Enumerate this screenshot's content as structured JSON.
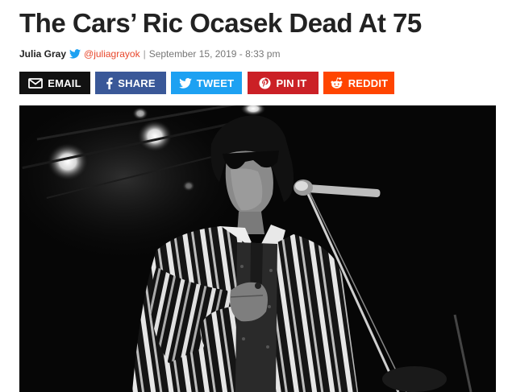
{
  "article": {
    "headline": "The Cars’ Ric Ocasek Dead At 75",
    "author": "Julia Gray",
    "twitter_handle": "@juliagrayok",
    "separator": "|",
    "date": "September 15, 2019 - 8:33 pm"
  },
  "share_buttons": {
    "email": {
      "label": "EMAIL",
      "icon": "envelope-icon",
      "color": "#111111"
    },
    "facebook": {
      "label": "SHARE",
      "icon": "facebook-icon",
      "color": "#3a5898"
    },
    "twitter": {
      "label": "TWEET",
      "icon": "twitter-icon",
      "color": "#1da1f2"
    },
    "pinterest": {
      "label": "PIN IT",
      "icon": "pinterest-icon",
      "color": "#cb2026"
    },
    "reddit": {
      "label": "REDDIT",
      "icon": "reddit-icon",
      "color": "#ff4500"
    }
  },
  "colors": {
    "handle": "#e8472c",
    "headline": "#222222"
  }
}
